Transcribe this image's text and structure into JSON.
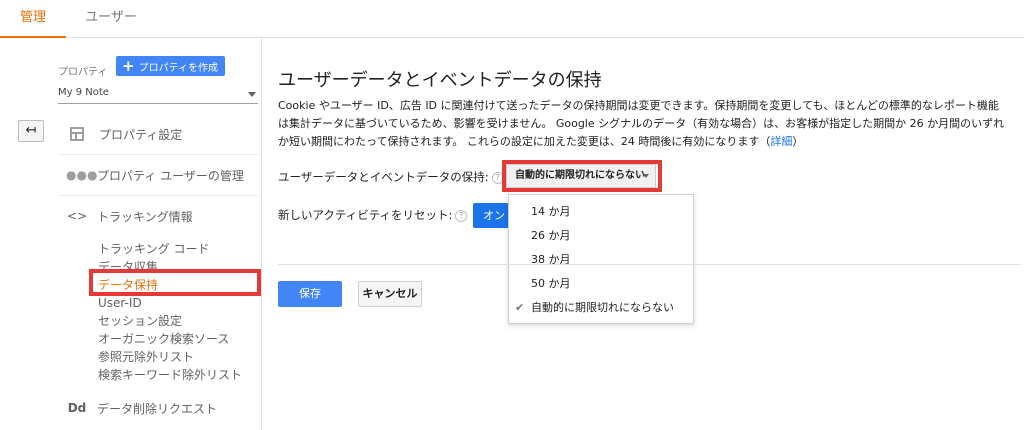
{
  "tabs": {
    "admin": "管理",
    "user": "ユーザー"
  },
  "left": {
    "property_label": "プロパティ",
    "create_button": "プロパティを作成",
    "property_selected": "My 9 Note",
    "back_icon": "back-arrow-icon",
    "nav": {
      "settings": "プロパティ設定",
      "user_management": "プロパティ ユーザーの管理",
      "tracking_info": "トラッキング情報",
      "tracking_icon": "<>",
      "data_deletion": "データ削除リクエスト",
      "data_deletion_icon": "Dd"
    },
    "sub_items": {
      "tracking_code": "トラッキング コード",
      "data_collection": "データ収集",
      "data_retention": "データ保持",
      "user_id": "User-ID",
      "session_settings": "セッション設定",
      "organic_sources": "オーガニック検索ソース",
      "referral_exclusion": "参照元除外リスト",
      "search_term_exclusion": "検索キーワード除外リスト"
    }
  },
  "main": {
    "title": "ユーザーデータとイベントデータの保持",
    "description_line1": "Cookie やユーザー ID、広告 ID に関連付けて送ったデータの保持期間は変更できます。保持期間を変更しても、ほとんどの標準的なレポート機能",
    "description_line2": "は集計データに基づいているため、影響を受けません。 Google シグナルのデータ（有効な場合）は、お客様が指定した期間か 26 か月間のいずれ",
    "description_line3": "か短い期間にわたって保持されます。 これらの設定に加えた変更は、24 時間後に有効になります（",
    "description_link": "詳細",
    "description_end": "）",
    "retention_label": "ユーザーデータとイベントデータの保持:",
    "retention_value": "自動的に期限切れにならない",
    "reset_label": "新しいアクティビティをリセット:",
    "reset_button": "オン",
    "help_glyph": "?",
    "dropdown_options": [
      "14 か月",
      "26 か月",
      "38 か月",
      "50 か月",
      "自動的に期限切れにならない"
    ],
    "dropdown_selected_index": 4,
    "save_button": "保存",
    "cancel_button": "キャンセル"
  },
  "colors": {
    "accent": "#e8710a",
    "primary": "#4285f4",
    "highlight": "#e53935"
  }
}
